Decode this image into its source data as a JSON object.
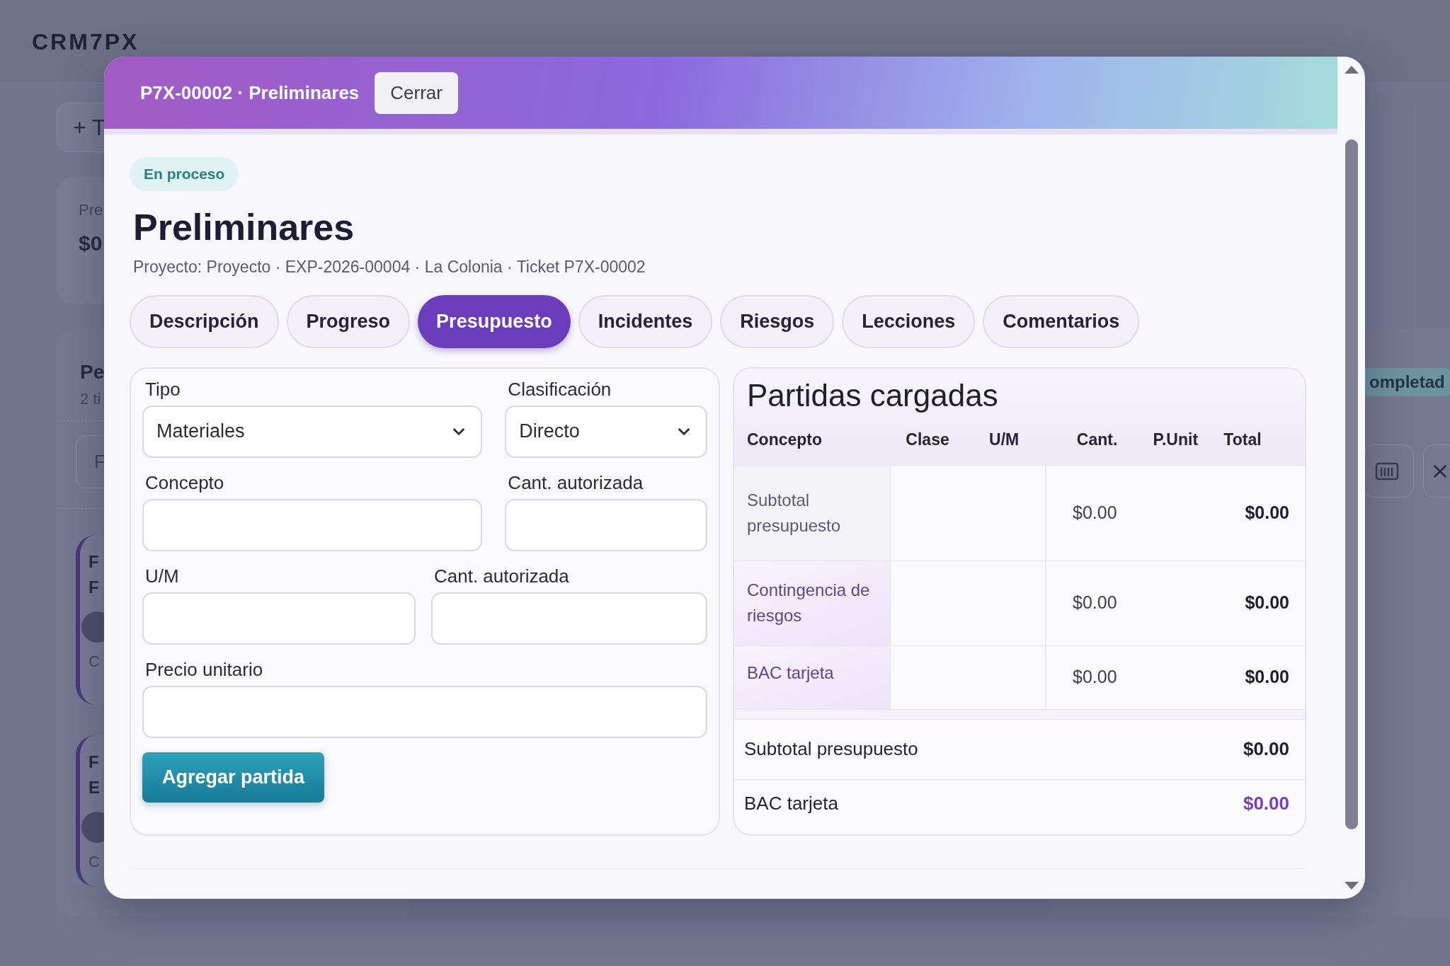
{
  "app": {
    "logo": "CRM7PX"
  },
  "background": {
    "new_button": "+ T",
    "summary_card": {
      "label": "Pre",
      "value": "$0"
    },
    "panel": {
      "title": "Pe",
      "subtitle": "2 ti",
      "field": "F",
      "cards": [
        {
          "lines": [
            "F",
            "F"
          ],
          "footer": "C"
        },
        {
          "lines": [
            "F",
            "E"
          ],
          "footer": "C"
        }
      ]
    },
    "status_badge": "ompletad"
  },
  "modal": {
    "title": "P7X-00002 · Preliminares",
    "close_button": "Cerrar",
    "status": "En proceso",
    "heading": "Preliminares",
    "subtitle": "Proyecto: Proyecto · EXP-2026-00004 · La Colonia · Ticket P7X-00002",
    "tabs": [
      {
        "label": "Descripción",
        "selected": false
      },
      {
        "label": "Progreso",
        "selected": false
      },
      {
        "label": "Presupuesto",
        "selected": true
      },
      {
        "label": "Incidentes",
        "selected": false
      },
      {
        "label": "Riesgos",
        "selected": false
      },
      {
        "label": "Lecciones",
        "selected": false
      },
      {
        "label": "Comentarios",
        "selected": false
      }
    ],
    "form": {
      "fields": [
        {
          "kind": "select",
          "label": "Tipo",
          "value": "Materiales"
        },
        {
          "kind": "select",
          "label": "Clasificación",
          "value": "Directo"
        },
        {
          "kind": "input",
          "label": "Concepto"
        },
        {
          "kind": "input",
          "label": "Cant. autorizada"
        },
        {
          "kind": "input",
          "label": "U/M"
        },
        {
          "kind": "input",
          "label": "Cant. autorizada"
        },
        {
          "kind": "input",
          "label": "Precio unitario"
        }
      ],
      "submit_button": "Agregar partida"
    },
    "table": {
      "title": "Partidas cargadas",
      "columns": [
        "Concepto",
        "Clase",
        "U/M",
        "Cant.",
        "P.Unit",
        "Total"
      ],
      "rows": [
        {
          "concepto": "Subtotal presupuesto",
          "cant": "$0.00",
          "total": "$0.00"
        },
        {
          "concepto": "Contingencia de riesgos",
          "cant": "$0.00",
          "total": "$0.00"
        },
        {
          "concepto": "BAC tarjeta",
          "cant": "$0.00",
          "total": "$0.00"
        }
      ],
      "summary": [
        {
          "label": "Subtotal presupuesto",
          "value": "$0.00",
          "highlight": false
        },
        {
          "label": "BAC tarjeta",
          "value": "$0.00",
          "highlight": true
        }
      ]
    }
  }
}
